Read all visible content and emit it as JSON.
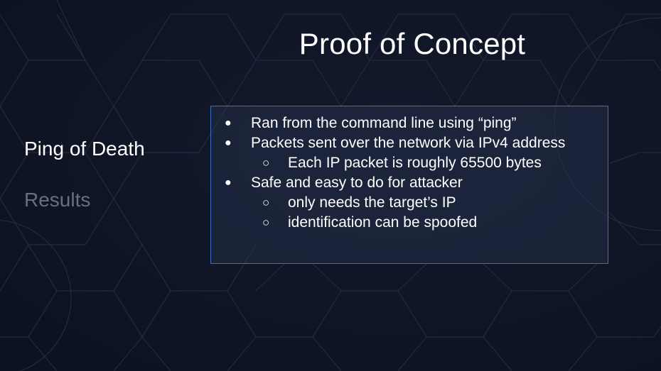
{
  "slide": {
    "title": "Proof of Concept",
    "nav": {
      "active_label": "Ping of Death",
      "inactive_label": "Results"
    },
    "bullets": [
      {
        "level": 1,
        "marker": "●",
        "text": "Ran from the command line using “ping”"
      },
      {
        "level": 1,
        "marker": "●",
        "text": "Packets sent over the network via IPv4 address"
      },
      {
        "level": 2,
        "marker": "○",
        "text": "Each IP packet is roughly 65500 bytes"
      },
      {
        "level": 1,
        "marker": "●",
        "text": "Safe and easy to do for attacker"
      },
      {
        "level": 2,
        "marker": "○",
        "text": "only needs the target’s IP"
      },
      {
        "level": 2,
        "marker": "○",
        "text": "identification can be spoofed"
      }
    ]
  },
  "colors": {
    "background": "#0f1525",
    "box_border": "#3d6fc4",
    "inactive_text": "#6b6f7a",
    "pattern_lines": "#2a3144"
  }
}
